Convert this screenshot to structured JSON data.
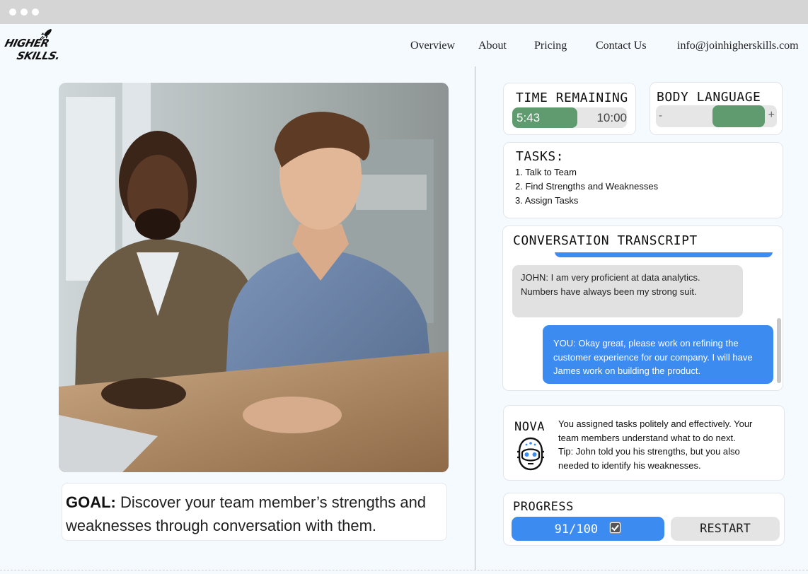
{
  "browser": {
    "window_dots": 3
  },
  "logo": {
    "line1": "HIGHER",
    "line2": "SKILLS."
  },
  "nav": {
    "items": [
      "Overview",
      "About",
      "Pricing",
      "Contact Us"
    ],
    "email": "info@joinhigherskills.com"
  },
  "goal": {
    "label": "GOAL:",
    "text": "Discover your team member’s strengths and weaknesses through conversation with them."
  },
  "timer": {
    "title": "TIME REMAINING",
    "current": "5:43",
    "total": "10:00",
    "progress_fraction": 0.57,
    "color": "#5f9b6f"
  },
  "body_language": {
    "title": "BODY LANGUAGE",
    "minus": "-",
    "plus": "+",
    "level_start_fraction": 0.47,
    "level_end_fraction": 0.9,
    "color": "#5f9b6f"
  },
  "tasks": {
    "title": "TASKS:",
    "items": [
      "1. Talk to Team",
      "2. Find Strengths and Weaknesses",
      "3. Assign Tasks"
    ]
  },
  "transcript": {
    "title": "CONVERSATION TRANSCRIPT",
    "messages": [
      {
        "speaker": "JOHN",
        "text": "JOHN: I am very proficient at data analytics. Numbers have always been my strong suit."
      },
      {
        "speaker": "YOU",
        "text": "YOU: Okay great, please work on refining the customer experience for our company. I will have James work on building the product."
      }
    ],
    "you_color": "#3b8bf0"
  },
  "nova": {
    "title": "NOVA",
    "icon": "robot-head-icon",
    "message": "You assigned tasks politely and effectively. Your team members understand what to do next.",
    "tip": "Tip: John told you his strengths, but you also needed to identify his weaknesses."
  },
  "progress": {
    "title": "PROGRESS",
    "score": "91/100",
    "check_icon": "checkbox-checked-icon",
    "restart_label": "RESTART",
    "accent": "#3b8bf0"
  }
}
